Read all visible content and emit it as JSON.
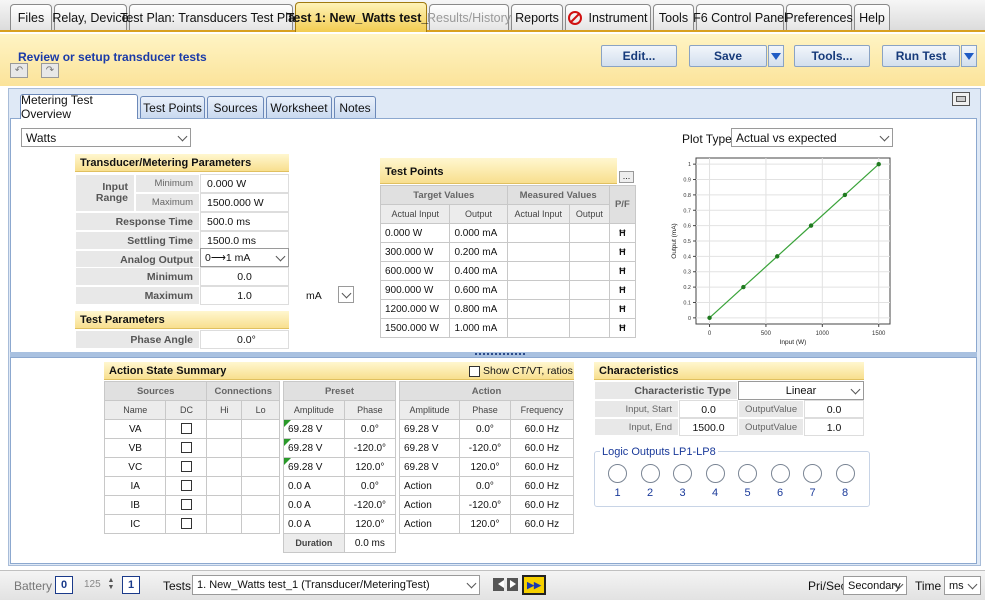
{
  "top_tabs": [
    {
      "label": "Files"
    },
    {
      "label": "Relay, Device"
    },
    {
      "label": "Test Plan: Transducers Test Plan"
    },
    {
      "label": "Test 1: New_Watts test_1"
    },
    {
      "label": "Results/History"
    },
    {
      "label": "Reports"
    },
    {
      "label": "Instrument"
    },
    {
      "label": "Tools"
    },
    {
      "label": "F6 Control Panel"
    },
    {
      "label": "Preferences"
    },
    {
      "label": "Help"
    }
  ],
  "header": {
    "title": "Review or setup transducer tests",
    "edit_label": "Edit...",
    "save_label": "Save",
    "tools_label": "Tools...",
    "run_label": "Run Test"
  },
  "sub_tabs": [
    {
      "label": "Metering Test Overview"
    },
    {
      "label": "Test Points"
    },
    {
      "label": "Sources"
    },
    {
      "label": "Worksheet"
    },
    {
      "label": "Notes"
    }
  ],
  "measurement_select": "Watts",
  "transducer": {
    "title": "Transducer/Metering Parameters",
    "input_range_label": "Input Range",
    "minimum_small": "Minimum",
    "maximum_small": "Maximum",
    "input_min": "0.000 W",
    "input_max": "1500.000 W",
    "response_time_label": "Response Time",
    "response_time": "500.0 ms",
    "settling_time_label": "Settling Time",
    "settling_time": "1500.0 ms",
    "analog_output_label": "Analog Output",
    "analog_output": "0⟶1 mA",
    "minimum_label": "Minimum",
    "minimum": "0.0",
    "maximum_label": "Maximum",
    "maximum": "1.0",
    "unit": "mA"
  },
  "test_parameters": {
    "title": "Test Parameters",
    "phase_angle_label": "Phase Angle",
    "phase_angle": "0.0°"
  },
  "test_points": {
    "title": "Test Points",
    "more_label": "...",
    "target_header": "Target Values",
    "measured_header": "Measured Values",
    "pf_header": "P/F",
    "col_actual_input": "Actual Input",
    "col_output": "Output",
    "col_meas_actual_input": "Actual Input",
    "col_meas_output": "Output",
    "rows": [
      {
        "input": "0.000 W",
        "output": "0.000 mA",
        "pf": "Ħ"
      },
      {
        "input": "300.000 W",
        "output": "0.200 mA",
        "pf": "Ħ"
      },
      {
        "input": "600.000 W",
        "output": "0.400 mA",
        "pf": "Ħ"
      },
      {
        "input": "900.000 W",
        "output": "0.600 mA",
        "pf": "Ħ"
      },
      {
        "input": "1200.000 W",
        "output": "0.800 mA",
        "pf": "Ħ"
      },
      {
        "input": "1500.000 W",
        "output": "1.000 mA",
        "pf": "Ħ"
      }
    ]
  },
  "plot": {
    "type_label": "Plot Type",
    "type_value": "Actual vs expected"
  },
  "chart_data": {
    "type": "line",
    "x": [
      0,
      300,
      600,
      900,
      1200,
      1500
    ],
    "y": [
      0,
      0.2,
      0.4,
      0.6,
      0.8,
      1.0
    ],
    "xlabel": "Input (W)",
    "ylabel": "Output (mA)",
    "xlim": [
      -120,
      1600
    ],
    "ylim": [
      -0.04,
      1.04
    ],
    "xticks": [
      "0",
      "500",
      "1000",
      "1500"
    ],
    "yticks": [
      "0",
      "0.1",
      "0.2",
      "0.3",
      "0.4",
      "0.5",
      "0.6",
      "0.7",
      "0.8",
      "0.9",
      "1"
    ],
    "grid": true,
    "color": "#3aa33a"
  },
  "action_state": {
    "title": "Action State Summary",
    "show_ctvt": "Show CT/VT, ratios",
    "sources_header": "Sources",
    "connections_header": "Connections",
    "preset_header": "Preset",
    "action_header": "Action",
    "col_name": "Name",
    "col_dc": "DC",
    "col_hi": "Hi",
    "col_lo": "Lo",
    "col_amplitude": "Amplitude",
    "col_phase": "Phase",
    "col_a_amplitude": "Amplitude",
    "col_a_phase": "Phase",
    "col_frequency": "Frequency",
    "rows": [
      {
        "name": "VA",
        "preset_amp": "69.28 V",
        "preset_phase": "0.0°",
        "action_amp": "69.28 V",
        "action_phase": "0.0°",
        "freq": "60.0 Hz"
      },
      {
        "name": "VB",
        "preset_amp": "69.28 V",
        "preset_phase": "-120.0°",
        "action_amp": "69.28 V",
        "action_phase": "-120.0°",
        "freq": "60.0 Hz"
      },
      {
        "name": "VC",
        "preset_amp": "69.28 V",
        "preset_phase": "120.0°",
        "action_amp": "69.28 V",
        "action_phase": "120.0°",
        "freq": "60.0 Hz"
      },
      {
        "name": "IA",
        "preset_amp": "0.0 A",
        "preset_phase": "0.0°",
        "action_amp": "Action",
        "action_phase": "0.0°",
        "freq": "60.0 Hz"
      },
      {
        "name": "IB",
        "preset_amp": "0.0 A",
        "preset_phase": "-120.0°",
        "action_amp": "Action",
        "action_phase": "-120.0°",
        "freq": "60.0 Hz"
      },
      {
        "name": "IC",
        "preset_amp": "0.0 A",
        "preset_phase": "120.0°",
        "action_amp": "Action",
        "action_phase": "120.0°",
        "freq": "60.0 Hz"
      }
    ],
    "duration_label": "Duration",
    "duration": "0.0 ms"
  },
  "characteristics": {
    "title": "Characteristics",
    "type_label": "Characteristic Type",
    "type_value": "Linear",
    "input_start_label": "Input, Start",
    "input_start": "0.0",
    "output_value_label_1": "OutputValue",
    "output_value_1": "0.0",
    "input_end_label": "Input, End",
    "input_end": "1500.0",
    "output_value_label_2": "OutputValue",
    "output_value_2": "1.0"
  },
  "logic_outputs": {
    "title": "Logic Outputs LP1-LP8",
    "items": [
      "1",
      "2",
      "3",
      "4",
      "5",
      "6",
      "7",
      "8"
    ]
  },
  "bottom": {
    "battery_label": "Battery",
    "battery_value": "0",
    "spin_value": "125",
    "page_value": "1",
    "tests_label": "Tests",
    "tests_value": "1. New_Watts test_1 (Transducer/MeteringTest)",
    "prisec_label": "Pri/Sec",
    "prisec_value": "Secondary",
    "time_label": "Time",
    "time_value": "ms"
  }
}
